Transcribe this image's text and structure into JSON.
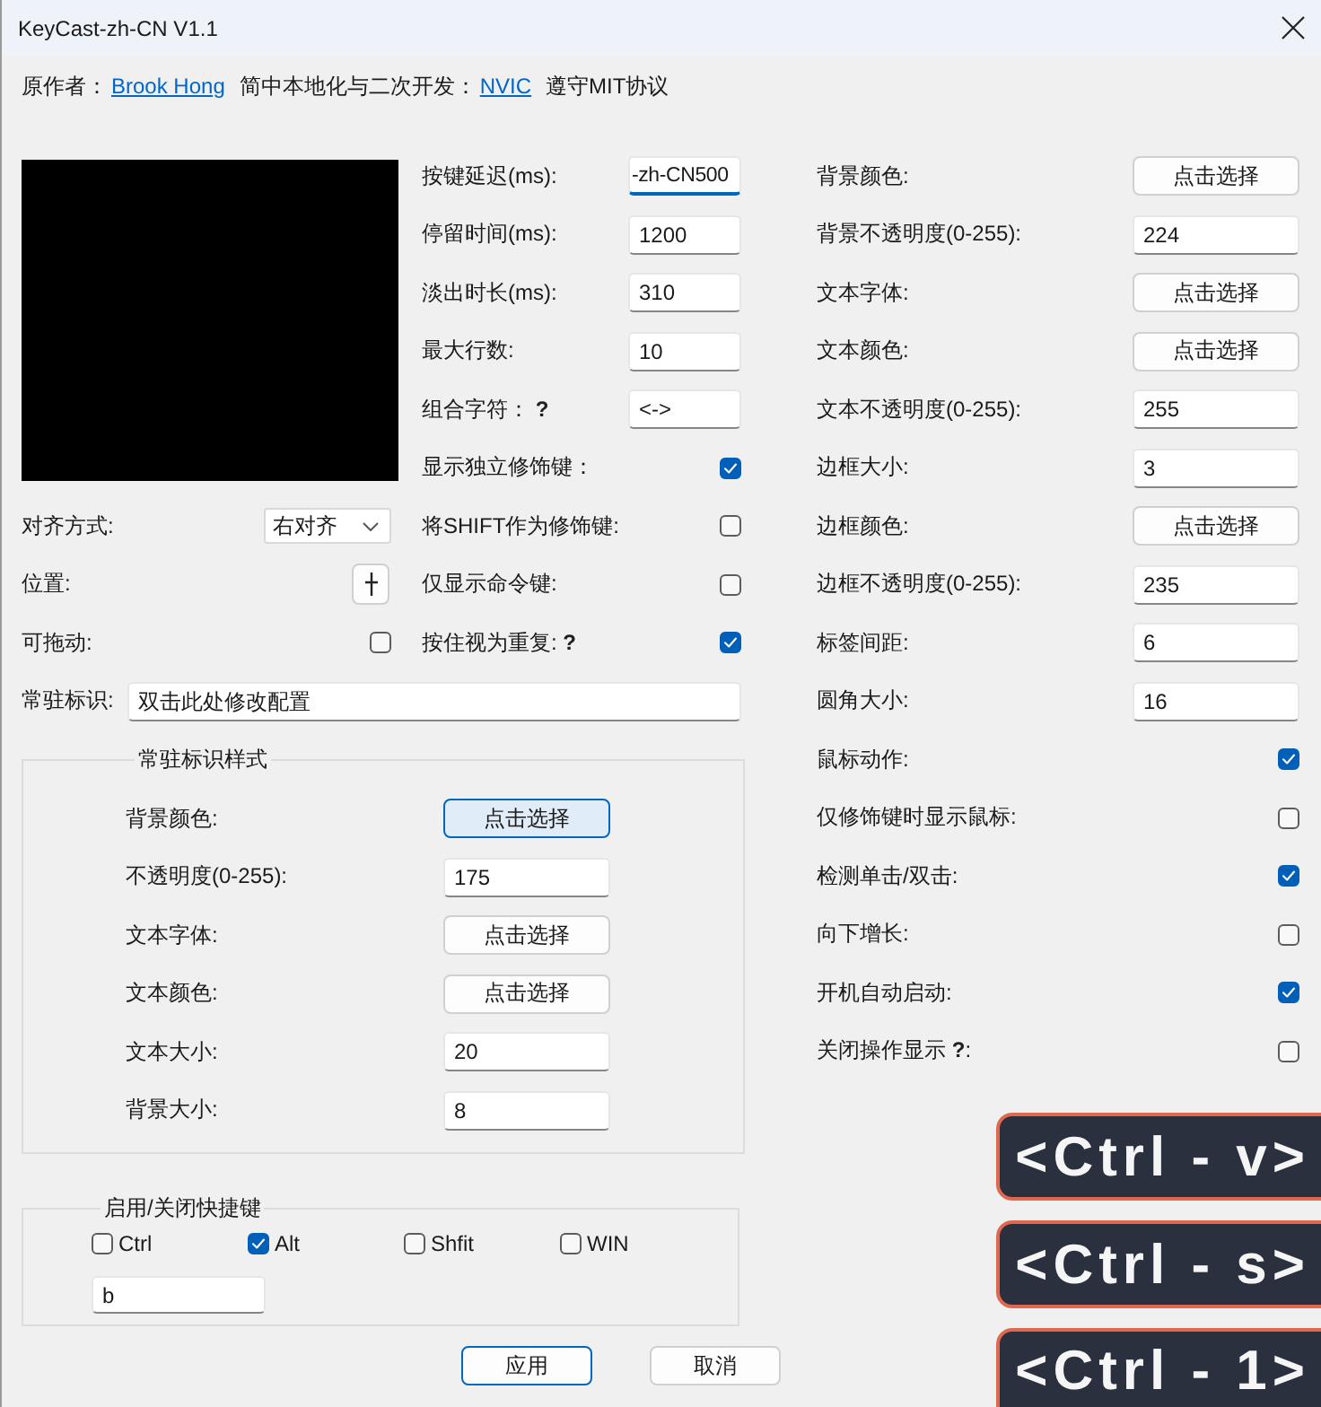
{
  "window": {
    "title": "KeyCast-zh-CN V1.1"
  },
  "credits": [
    {
      "kind": "text",
      "text": "原作者："
    },
    {
      "kind": "link",
      "text": "Brook Hong"
    },
    {
      "kind": "text",
      "text": "简中本地化与二次开发："
    },
    {
      "kind": "link",
      "text": "NVIC"
    },
    {
      "kind": "text",
      "text": "遵守MIT协议"
    }
  ],
  "left_settings": [
    {
      "kind": "dropdown",
      "label": "对齐方式:",
      "value": "右对齐"
    },
    {
      "kind": "picker",
      "label": "位置:"
    },
    {
      "kind": "checkbox",
      "label": "可拖动:",
      "checked": false
    }
  ],
  "middle_settings": [
    {
      "kind": "input",
      "label": "按键延迟(ms):",
      "value": "-zh-CN500",
      "focused": true
    },
    {
      "kind": "input",
      "label": "停留时间(ms):",
      "value": "1200",
      "focused": false
    },
    {
      "kind": "input",
      "label": "淡出时长(ms):",
      "value": "310",
      "focused": false
    },
    {
      "kind": "input",
      "label": "最大行数:",
      "value": "10",
      "focused": false
    },
    {
      "kind": "input",
      "label": "组合字符： **?**",
      "value": "<->",
      "focused": false
    },
    {
      "kind": "checkbox",
      "label": "显示独立修饰键：",
      "checked": true
    },
    {
      "kind": "checkbox",
      "label": "将SHIFT作为修饰键:",
      "checked": false
    },
    {
      "kind": "checkbox",
      "label": "仅显示命令键:",
      "checked": false
    },
    {
      "kind": "checkbox",
      "label": "按住视为重复: **?**",
      "checked": true
    }
  ],
  "label_text": {
    "label": "常驻标识:",
    "value": "双击此处修改配置"
  },
  "label_style": {
    "title": "常驻标识样式",
    "items": [
      {
        "kind": "button",
        "label": "背景颜色:",
        "text": "点击选择",
        "focused": true
      },
      {
        "kind": "input",
        "label": "不透明度(0-255):",
        "value": "175",
        "focused": false
      },
      {
        "kind": "button",
        "label": "文本字体:",
        "text": "点击选择",
        "focused": false
      },
      {
        "kind": "button",
        "label": "文本颜色:",
        "text": "点击选择",
        "focused": false
      },
      {
        "kind": "input",
        "label": "文本大小:",
        "value": "20",
        "focused": false
      },
      {
        "kind": "input",
        "label": "背景大小:",
        "value": "8",
        "focused": false
      }
    ]
  },
  "hotkey": {
    "title": "启用/关闭快捷键",
    "modifiers": [
      {
        "label": "Ctrl",
        "checked": false
      },
      {
        "label": "Alt",
        "checked": true
      },
      {
        "label": "Shfit",
        "checked": false
      },
      {
        "label": "WIN",
        "checked": false
      }
    ],
    "key": "b"
  },
  "right_settings": [
    {
      "kind": "button",
      "label": "背景颜色:",
      "text": "点击选择",
      "focused": false
    },
    {
      "kind": "input",
      "label": "背景不透明度(0-255):",
      "value": "224",
      "focused": false
    },
    {
      "kind": "button",
      "label": "文本字体:",
      "text": "点击选择",
      "focused": false
    },
    {
      "kind": "button",
      "label": "文本颜色:",
      "text": "点击选择",
      "focused": false
    },
    {
      "kind": "input",
      "label": "文本不透明度(0-255):",
      "value": "255",
      "focused": false
    },
    {
      "kind": "input",
      "label": "边框大小:",
      "value": "3",
      "focused": false
    },
    {
      "kind": "button",
      "label": "边框颜色:",
      "text": "点击选择",
      "focused": false
    },
    {
      "kind": "input",
      "label": "边框不透明度(0-255):",
      "value": "235",
      "focused": false
    },
    {
      "kind": "input",
      "label": "标签间距:",
      "value": "6",
      "focused": false
    },
    {
      "kind": "input",
      "label": "圆角大小:",
      "value": "16",
      "focused": false
    },
    {
      "kind": "checkbox",
      "label": "鼠标动作:",
      "checked": true
    },
    {
      "kind": "checkbox",
      "label": "仅修饰键时显示鼠标:",
      "checked": false
    },
    {
      "kind": "checkbox",
      "label": "检测单击/双击:",
      "checked": true
    },
    {
      "kind": "checkbox",
      "label": "向下增长:",
      "checked": false
    },
    {
      "kind": "checkbox",
      "label": "开机自动启动:",
      "checked": true
    },
    {
      "kind": "checkbox",
      "label": "关闭操作显示 **?**:",
      "checked": false
    }
  ],
  "buttons": [
    {
      "label": "应用",
      "default": true
    },
    {
      "label": "取消",
      "default": false
    }
  ],
  "keystroke_overlay": [
    "<Ctrl - v>",
    "<Ctrl - s>",
    "<Ctrl - 1>"
  ]
}
